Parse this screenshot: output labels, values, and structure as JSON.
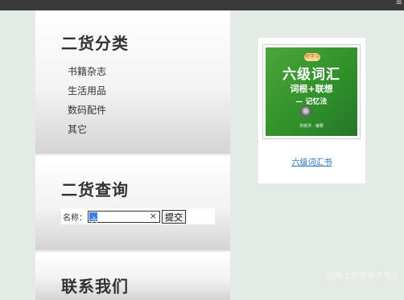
{
  "topbar": {
    "corner_glyph": "≡"
  },
  "categories": {
    "title": "二货分类",
    "items": [
      "书籍杂志",
      "生活用品",
      "数码配件",
      "其它"
    ]
  },
  "search": {
    "title": "二货查询",
    "label": "名称：",
    "value": "六",
    "clear_glyph": "×",
    "submit_label": "提交"
  },
  "contact": {
    "title": "联系我们"
  },
  "product": {
    "link_text": "六级词汇书",
    "cover": {
      "badge": "好学习",
      "title": "六级词汇",
      "line2": "词根+联想",
      "line3": "— 记忆法",
      "author": "俞敏洪 · 编著"
    }
  },
  "watermark": "@稀土掘金技术社区",
  "colors": {
    "link": "#1f6fbf",
    "page_bg": "#e4ebe6",
    "topbar": "#3a3a3a",
    "cover_green": "#3a9a32"
  }
}
